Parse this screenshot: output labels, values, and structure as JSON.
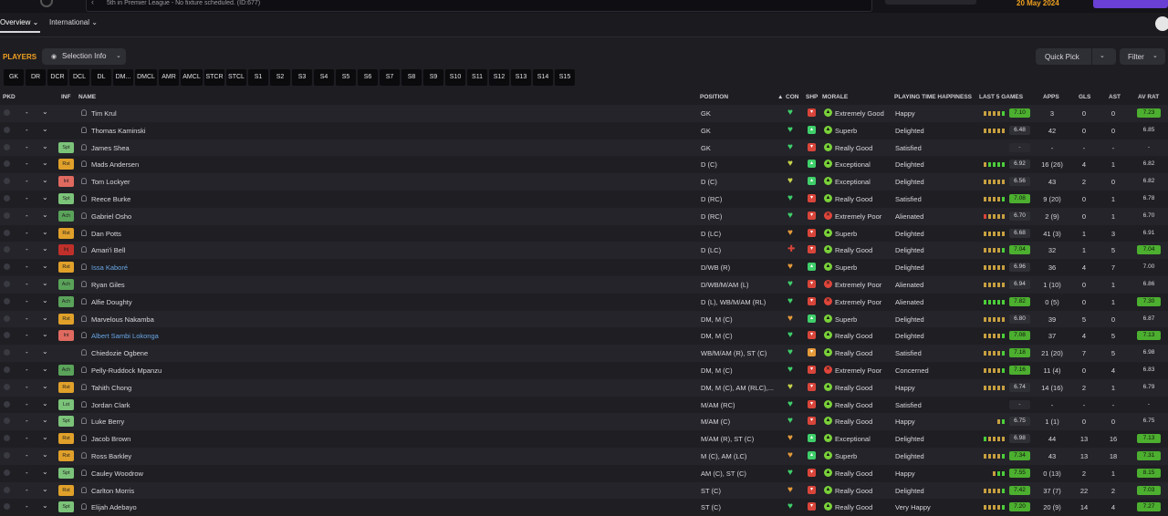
{
  "top": {
    "fixture_text": "5th in Premier League - No fixture scheduled. (ID:677)",
    "date": "20 May 2024"
  },
  "nav": {
    "tabs": [
      {
        "label": "Overview ⌄"
      },
      {
        "label": "International ⌄"
      }
    ]
  },
  "toolbar": {
    "title": "PLAYERS",
    "selection_label": "Selection Info",
    "quick_pick_label": "Quick Pick",
    "filter_label": "Filter"
  },
  "position_chips": [
    "GK",
    "DR",
    "DCR",
    "DCL",
    "DL",
    "DM...",
    "DMCL",
    "AMR",
    "AMCL",
    "STCR",
    "STCL",
    "S1",
    "S2",
    "S3",
    "S4",
    "S5",
    "S6",
    "S7",
    "S8",
    "S9",
    "S10",
    "S11",
    "S12",
    "S13",
    "S14",
    "S15"
  ],
  "headers": {
    "pkd": "PKD",
    "inf": "INF",
    "name": "NAME",
    "position": "POSITION",
    "con": "CON",
    "shp": "SHP",
    "morale": "MORALE",
    "playing_time": "PLAYING TIME HAPPINESS",
    "last5": "LAST 5 GAMES",
    "apps": "APPS",
    "gls": "GLS",
    "ast": "AST",
    "avrat": "AV RAT"
  },
  "colors": {
    "accent": "#f0a020",
    "green": "#4caf2f",
    "red": "#d9453a",
    "amber": "#e0a02a",
    "link": "#6aa7e6"
  },
  "players": [
    {
      "name": "Tim Krul",
      "inf": "",
      "inf_color": "",
      "pos": "GK",
      "con": "green",
      "shp": "red",
      "morale": "Extremely Good",
      "mor_color": "green",
      "pth": "Happy",
      "last5": [
        "o",
        "o",
        "o",
        "o",
        "g"
      ],
      "rating": "7.10",
      "apps": "3",
      "gls": "0",
      "ast": "0",
      "avrat": "7.23",
      "avrat_hl": true
    },
    {
      "name": "Thomas Kaminski",
      "inf": "",
      "inf_color": "",
      "pos": "GK",
      "con": "green",
      "shp": "green",
      "morale": "Superb",
      "mor_color": "green",
      "pth": "Delighted",
      "last5": [
        "o",
        "o",
        "o",
        "o",
        "o"
      ],
      "rating": "6.48",
      "apps": "42",
      "gls": "0",
      "ast": "0",
      "avrat": "6.85",
      "avrat_hl": false
    },
    {
      "name": "James Shea",
      "inf": "Spt",
      "inf_color": "#7cc37a",
      "pos": "GK",
      "con": "green",
      "shp": "red",
      "morale": "Really Good",
      "mor_color": "green",
      "pth": "Satisfied",
      "last5": [],
      "rating": "-",
      "apps": "-",
      "gls": "-",
      "ast": "-",
      "avrat": "-",
      "avrat_hl": false
    },
    {
      "name": "Mads Andersen",
      "inf": "Rst",
      "inf_color": "#e0a02a",
      "pos": "D (C)",
      "con": "yellow",
      "shp": "green",
      "morale": "Exceptional",
      "mor_color": "green",
      "pth": "Delighted",
      "last5": [
        "o",
        "g",
        "g",
        "g",
        "g"
      ],
      "rating": "6.92",
      "apps": "16 (26)",
      "gls": "4",
      "ast": "1",
      "avrat": "6.82",
      "avrat_hl": false
    },
    {
      "name": "Tom Lockyer",
      "inf": "Int",
      "inf_color": "#e06a60",
      "pos": "D (C)",
      "con": "yellow",
      "shp": "green",
      "morale": "Exceptional",
      "mor_color": "green",
      "pth": "Delighted",
      "last5": [
        "o",
        "o",
        "o",
        "o",
        "o"
      ],
      "rating": "6.56",
      "apps": "43",
      "gls": "2",
      "ast": "0",
      "avrat": "6.82",
      "avrat_hl": false
    },
    {
      "name": "Reece Burke",
      "inf": "Spt",
      "inf_color": "#7cc37a",
      "pos": "D (RC)",
      "con": "green",
      "shp": "red",
      "morale": "Really Good",
      "mor_color": "green",
      "pth": "Satisfied",
      "last5": [
        "o",
        "o",
        "o",
        "o",
        "g"
      ],
      "rating": "7.08",
      "apps": "9 (20)",
      "gls": "0",
      "ast": "1",
      "avrat": "6.78",
      "avrat_hl": false
    },
    {
      "name": "Gabriel Osho",
      "inf": "Ach",
      "inf_color": "#5aa35a",
      "pos": "D (RC)",
      "con": "green",
      "shp": "red",
      "morale": "Extremely Poor",
      "mor_color": "red",
      "pth": "Alienated",
      "last5": [
        "r",
        "o",
        "o",
        "o",
        "o"
      ],
      "rating": "6.70",
      "apps": "2 (9)",
      "gls": "0",
      "ast": "1",
      "avrat": "6.70",
      "avrat_hl": false
    },
    {
      "name": "Dan Potts",
      "inf": "Rst",
      "inf_color": "#e0a02a",
      "pos": "D (LC)",
      "con": "amber",
      "shp": "red",
      "morale": "Superb",
      "mor_color": "green",
      "pth": "Delighted",
      "last5": [
        "o",
        "o",
        "o",
        "o",
        "o"
      ],
      "rating": "6.68",
      "apps": "41 (3)",
      "gls": "1",
      "ast": "3",
      "avrat": "6.91",
      "avrat_hl": false
    },
    {
      "name": "Amari'i Bell",
      "inf": "Inj",
      "inf_color": "#c0302a",
      "pos": "D (LC)",
      "con": "injury",
      "shp": "red",
      "morale": "Really Good",
      "mor_color": "green",
      "pth": "Delighted",
      "last5": [
        "o",
        "o",
        "o",
        "o",
        "g"
      ],
      "rating": "7.04",
      "apps": "32",
      "gls": "1",
      "ast": "5",
      "avrat": "7.04",
      "avrat_hl": true
    },
    {
      "name": "Issa Kaboré",
      "inf": "Rst",
      "inf_color": "#e0a02a",
      "pos": "D/WB (R)",
      "con": "amber",
      "shp": "green",
      "morale": "Superb",
      "mor_color": "green",
      "pth": "Delighted",
      "last5": [
        "o",
        "o",
        "o",
        "o",
        "o"
      ],
      "rating": "6.96",
      "apps": "36",
      "gls": "4",
      "ast": "7",
      "avrat": "7.00",
      "avrat_hl": false,
      "link": true
    },
    {
      "name": "Ryan Giles",
      "inf": "Ach",
      "inf_color": "#5aa35a",
      "pos": "D/WB/M/AM (L)",
      "con": "green",
      "shp": "red",
      "morale": "Extremely Poor",
      "mor_color": "red",
      "pth": "Alienated",
      "last5": [
        "o",
        "o",
        "o",
        "o",
        "o"
      ],
      "rating": "6.94",
      "apps": "1 (10)",
      "gls": "0",
      "ast": "1",
      "avrat": "6.86",
      "avrat_hl": false
    },
    {
      "name": "Alfie Doughty",
      "inf": "Ach",
      "inf_color": "#5aa35a",
      "pos": "D (L), WB/M/AM (RL)",
      "con": "green",
      "shp": "red",
      "morale": "Extremely Poor",
      "mor_color": "red",
      "pth": "Alienated",
      "last5": [
        "g",
        "g",
        "g",
        "g",
        "g"
      ],
      "rating": "7.82",
      "apps": "0 (5)",
      "gls": "0",
      "ast": "1",
      "avrat": "7.30",
      "avrat_hl": true
    },
    {
      "name": "Marvelous Nakamba",
      "inf": "Rst",
      "inf_color": "#e0a02a",
      "pos": "DM, M (C)",
      "con": "amber",
      "shp": "green",
      "morale": "Superb",
      "mor_color": "green",
      "pth": "Delighted",
      "last5": [
        "o",
        "o",
        "o",
        "o",
        "o"
      ],
      "rating": "6.80",
      "apps": "39",
      "gls": "5",
      "ast": "0",
      "avrat": "6.87",
      "avrat_hl": false
    },
    {
      "name": "Albert Sambi Lokonga",
      "inf": "Int",
      "inf_color": "#e06a60",
      "pos": "DM, M (C)",
      "con": "green",
      "shp": "red",
      "morale": "Really Good",
      "mor_color": "green",
      "pth": "Delighted",
      "last5": [
        "o",
        "o",
        "o",
        "o",
        "g"
      ],
      "rating": "7.08",
      "apps": "37",
      "gls": "4",
      "ast": "5",
      "avrat": "7.13",
      "avrat_hl": true,
      "link": true
    },
    {
      "name": "Chiedozie Ogbene",
      "inf": "",
      "inf_color": "",
      "pos": "WB/M/AM (R), ST (C)",
      "con": "green",
      "shp": "amber",
      "morale": "Really Good",
      "mor_color": "green",
      "pth": "Satisfied",
      "last5": [
        "o",
        "o",
        "o",
        "o",
        "g"
      ],
      "rating": "7.18",
      "apps": "21 (20)",
      "gls": "7",
      "ast": "5",
      "avrat": "6.98",
      "avrat_hl": false
    },
    {
      "name": "Pelly-Ruddock Mpanzu",
      "inf": "Ach",
      "inf_color": "#5aa35a",
      "pos": "DM, M (C)",
      "con": "green",
      "shp": "red",
      "morale": "Extremely Poor",
      "mor_color": "red",
      "pth": "Concerned",
      "last5": [
        "o",
        "o",
        "o",
        "o",
        "g"
      ],
      "rating": "7.16",
      "apps": "11 (4)",
      "gls": "0",
      "ast": "4",
      "avrat": "6.83",
      "avrat_hl": false
    },
    {
      "name": "Tahith Chong",
      "inf": "Rst",
      "inf_color": "#e0a02a",
      "pos": "DM, M (C), AM (RLC),...",
      "con": "yellow",
      "shp": "red",
      "morale": "Really Good",
      "mor_color": "green",
      "pth": "Happy",
      "last5": [
        "o",
        "o",
        "o",
        "o",
        "o"
      ],
      "rating": "6.74",
      "apps": "14 (16)",
      "gls": "2",
      "ast": "1",
      "avrat": "6.79",
      "avrat_hl": false
    },
    {
      "name": "Jordan Clark",
      "inf": "Lst",
      "inf_color": "#7cc37a",
      "pos": "M/AM (RC)",
      "con": "green",
      "shp": "red",
      "morale": "Really Good",
      "mor_color": "green",
      "pth": "Satisfied",
      "last5": [],
      "rating": "-",
      "apps": "-",
      "gls": "-",
      "ast": "-",
      "avrat": "-",
      "avrat_hl": false
    },
    {
      "name": "Luke Berry",
      "inf": "Spt",
      "inf_color": "#7cc37a",
      "pos": "M/AM (C)",
      "con": "green",
      "shp": "red",
      "morale": "Really Good",
      "mor_color": "green",
      "pth": "Happy",
      "last5": [
        "o",
        "g"
      ],
      "rating": "6.75",
      "apps": "1 (1)",
      "gls": "0",
      "ast": "0",
      "avrat": "6.75",
      "avrat_hl": false
    },
    {
      "name": "Jacob Brown",
      "inf": "Rst",
      "inf_color": "#e0a02a",
      "pos": "M/AM (R), ST (C)",
      "con": "amber",
      "shp": "green",
      "morale": "Exceptional",
      "mor_color": "green",
      "pth": "Delighted",
      "last5": [
        "g",
        "o",
        "o",
        "o",
        "o"
      ],
      "rating": "6.98",
      "apps": "44",
      "gls": "13",
      "ast": "16",
      "avrat": "7.13",
      "avrat_hl": true
    },
    {
      "name": "Ross Barkley",
      "inf": "Rst",
      "inf_color": "#e0a02a",
      "pos": "M (C), AM (LC)",
      "con": "amber",
      "shp": "green",
      "morale": "Superb",
      "mor_color": "green",
      "pth": "Delighted",
      "last5": [
        "o",
        "o",
        "o",
        "o",
        "g"
      ],
      "rating": "7.34",
      "apps": "43",
      "gls": "13",
      "ast": "18",
      "avrat": "7.31",
      "avrat_hl": true
    },
    {
      "name": "Cauley Woodrow",
      "inf": "Spt",
      "inf_color": "#7cc37a",
      "pos": "AM (C), ST (C)",
      "con": "green",
      "shp": "red",
      "morale": "Really Good",
      "mor_color": "green",
      "pth": "Happy",
      "last5": [
        "o",
        "g",
        "g"
      ],
      "rating": "7.55",
      "apps": "0 (13)",
      "gls": "2",
      "ast": "1",
      "avrat": "8.15",
      "avrat_hl": true
    },
    {
      "name": "Carlton Morris",
      "inf": "Rst",
      "inf_color": "#e0a02a",
      "pos": "ST (C)",
      "con": "amber",
      "shp": "red",
      "morale": "Really Good",
      "mor_color": "green",
      "pth": "Delighted",
      "last5": [
        "o",
        "o",
        "o",
        "o",
        "g"
      ],
      "rating": "7.42",
      "apps": "37 (7)",
      "gls": "22",
      "ast": "2",
      "avrat": "7.03",
      "avrat_hl": true
    },
    {
      "name": "Elijah Adebayo",
      "inf": "Spt",
      "inf_color": "#7cc37a",
      "pos": "ST (C)",
      "con": "green",
      "shp": "red",
      "morale": "Really Good",
      "mor_color": "green",
      "pth": "Very Happy",
      "last5": [
        "o",
        "o",
        "o",
        "o",
        "g"
      ],
      "rating": "7.20",
      "apps": "20 (9)",
      "gls": "14",
      "ast": "4",
      "avrat": "7.27",
      "avrat_hl": true
    }
  ]
}
